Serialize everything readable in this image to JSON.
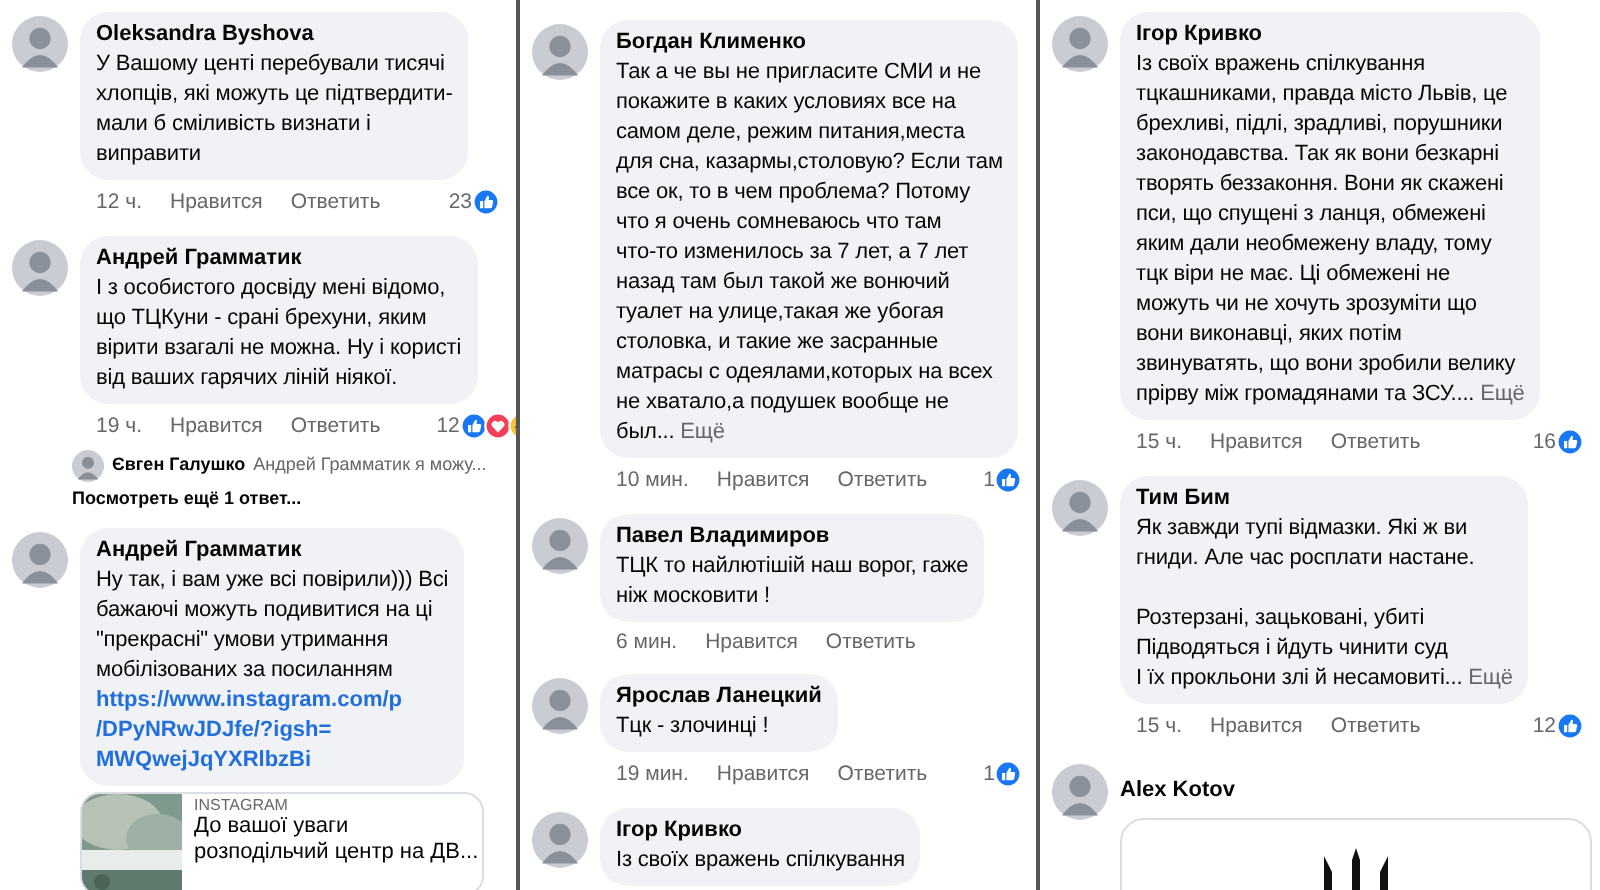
{
  "panels": [
    {
      "comments": [
        {
          "author": "Oleksandra Byshova",
          "body": "У Вашому центі перебували тисячі\nхлопців, які можуть це підтвердити-\nмали б сміливість визнати і\nвиправити",
          "time": "12 ч.",
          "like": "Нравится",
          "reply": "Ответить",
          "count": "23",
          "reactions": [
            {
              "kind": "like"
            }
          ]
        },
        {
          "author": "Андрей Грамматик",
          "body": "І з особистого досвіду мені відомо,\nщо ТЦКуни - срані брехуни, яким\nвірити взагалі не можна. Ну і користі\nвід ваших гарячих ліній ніякої.",
          "time": "19 ч.",
          "like": "Нравится",
          "reply": "Ответить",
          "count": "12",
          "reactions": [
            {
              "kind": "like"
            },
            {
              "kind": "love"
            },
            {
              "kind": "haha"
            }
          ],
          "reply_preview": {
            "author": "Євген Галушко",
            "text": "Андрей Грамматик я можу..."
          },
          "more_replies": "Посмотреть ещё 1 ответ..."
        },
        {
          "author": "Андрей Грамматик",
          "body": "Ну так, і вам уже всі повірили))) Всі\nбажаючі можуть подивитися на ці\n\"прекрасні\" умови утримання\nмобілізованих за посиланням",
          "link": "https://www.instagram.com/p\n/DPyNRwJDJfe/?igsh=\nMWQwejJqYXRlbzBi",
          "preview": {
            "source": "INSTAGRAM",
            "title": "До вашої уваги\nрозподільчий центр на ДВ..."
          }
        }
      ]
    },
    {
      "comments": [
        {
          "author": "Богдан Клименко",
          "body": "Так а че вы не пригласите СМИ и не\nпокажите в каких условиях все на\nсамом деле, режим питания,места\nдля сна, казармы,столовую? Если там\nвсе ок, то в чем проблема? Потому\nчто я очень сомневаюсь что там\nчто-то изменилось за 7 лет, а 7 лет\nназад там был такой же вонючий\nтуалет на улице,такая же убогая\nстоловка, и такие же засранные\nматрасы с одеялами,которых на всех\nне хватало,а подушек вообще не\nбыл...",
          "more": "Ещё",
          "time": "10 мин.",
          "like": "Нравится",
          "reply": "Ответить",
          "count": "1",
          "reactions": [
            {
              "kind": "like"
            }
          ]
        },
        {
          "author": "Павел Владимиров",
          "body": "ТЦК то найлютішій наш ворог, гаже\nніж московити !",
          "time": "6 мин.",
          "like": "Нравится",
          "reply": "Ответить"
        },
        {
          "author": "Ярослав Ланецкий",
          "body": "Тцк - злочинці !",
          "time": "19 мин.",
          "like": "Нравится",
          "reply": "Ответить",
          "count": "1",
          "reactions": [
            {
              "kind": "like"
            }
          ]
        },
        {
          "author": "Ігор Кривко",
          "body": "Із своїх вражень спілкування"
        }
      ]
    },
    {
      "comments": [
        {
          "author": "Ігор Кривко",
          "body": "Із своїх вражень спілкування\nтцкашниками, правда місто Львів, це\nбрехливі, підлі, зрадливі, порушники\nзаконодавства. Так як вони безкарні\nтворять беззаконня. Вони як скажені\nпси, що спущені з ланця, обмежені\nяким дали необмежену владу, тому\nтцк віри не має. Ці обмежені не\nможуть чи не хочуть зрозуміти що\nвони виконавці, яких потім\nзвинуватять, що вони зробили велику\nпрірву між громадянами та ЗСУ....",
          "more": "Ещё",
          "time": "15 ч.",
          "like": "Нравится",
          "reply": "Ответить",
          "count": "16",
          "reactions": [
            {
              "kind": "like"
            }
          ]
        },
        {
          "author": "Тим Бим",
          "body": "Як завжди тупі відмазки. Які ж ви\nгниди. Але час росплати настане.\n\nРозтерзані, зацьковані, убиті\nПідводяться і йдуть чинити суд\nІ їх прокльони злі й несамовиті...",
          "more": "Ещё",
          "time": "15 ч.",
          "like": "Нравится",
          "reply": "Ответить",
          "count": "12",
          "reactions": [
            {
              "kind": "like"
            }
          ]
        },
        {
          "author": "Alex Kotov",
          "attachment": {
            "kind": "emblem"
          }
        }
      ]
    }
  ]
}
